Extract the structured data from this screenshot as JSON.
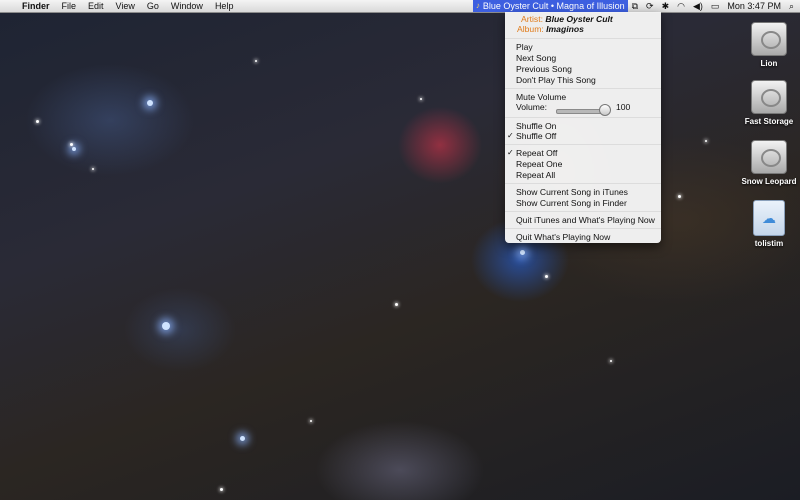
{
  "menubar": {
    "apple": "",
    "app_name": "Finder",
    "menus": [
      "File",
      "Edit",
      "View",
      "Go",
      "Window",
      "Help"
    ],
    "now_playing": "Blue Oyster Cult • Magna of Illusion",
    "clock": "Mon 3:47 PM",
    "spotlight": "⌕",
    "tray_icons": [
      "dropbox-icon",
      "sync-icon",
      "bluetooth-icon",
      "wifi-icon",
      "volume-icon",
      "battery-icon"
    ]
  },
  "menu": {
    "artist_label": "Artist:",
    "artist_value": "Blue Oyster Cult",
    "album_label": "Album:",
    "album_value": "Imaginos",
    "play": "Play",
    "next_song": "Next Song",
    "previous_song": "Previous Song",
    "dont_play": "Don't Play This Song",
    "mute_volume": "Mute Volume",
    "volume_label": "Volume:",
    "volume_value": "100",
    "volume_level": 1.0,
    "shuffle_on": "Shuffle On",
    "shuffle_off": "Shuffle Off",
    "repeat_off": "Repeat Off",
    "repeat_one": "Repeat One",
    "repeat_all": "Repeat All",
    "show_itunes": "Show Current Song in iTunes",
    "show_finder": "Show Current Song in Finder",
    "quit_both": "Quit iTunes and What's Playing Now",
    "quit_wpn": "Quit What's Playing Now",
    "checkmark": "✓"
  },
  "desktop": {
    "icons": [
      {
        "label": "Lion"
      },
      {
        "label": "Fast Storage"
      },
      {
        "label": "Snow Leopard"
      },
      {
        "label": "tolistim"
      }
    ]
  }
}
